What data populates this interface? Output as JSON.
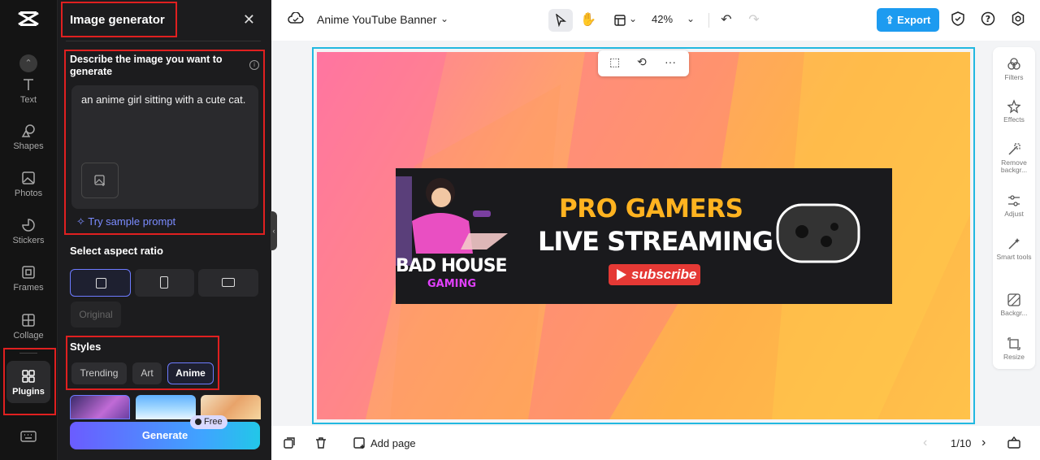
{
  "rail": {
    "logo_icon": "capcut-logo-icon",
    "items": [
      {
        "label": "Text",
        "icon": "text-icon"
      },
      {
        "label": "Shapes",
        "icon": "shapes-icon"
      },
      {
        "label": "Photos",
        "icon": "photos-icon"
      },
      {
        "label": "Stickers",
        "icon": "stickers-icon"
      },
      {
        "label": "Frames",
        "icon": "frames-icon"
      },
      {
        "label": "Collage",
        "icon": "collage-icon"
      }
    ],
    "plugins_label": "Plugins"
  },
  "panel": {
    "title": "Image generator",
    "describe_label": "Describe the image you want to generate",
    "prompt_value": "an anime girl sitting with a cute cat.",
    "sample_prompt": "Try sample prompt",
    "aspect_label": "Select aspect ratio",
    "original_label": "Original",
    "styles_label": "Styles",
    "style_tabs": [
      "Trending",
      "Art",
      "Anime"
    ],
    "active_style": "Anime",
    "generate_label": "Generate",
    "free_badge": "Free"
  },
  "topbar": {
    "doc_title": "Anime YouTube Banner",
    "zoom": "42%",
    "export_label": "Export"
  },
  "canvas": {
    "banner": {
      "title_line1": "PRO GAMERS",
      "title_line2": "LIVE STREAMING",
      "subscribe": "subscribe",
      "brand_line1": "BAD HOUSE",
      "brand_line2": "GAMING"
    }
  },
  "right_tools": [
    {
      "label": "Filters",
      "icon": "filters-icon"
    },
    {
      "label": "Effects",
      "icon": "effects-icon"
    },
    {
      "label": "Remove backgr...",
      "icon": "remove-background-icon"
    },
    {
      "label": "Adjust",
      "icon": "adjust-icon"
    },
    {
      "label": "Smart tools",
      "icon": "smart-tools-icon"
    },
    {
      "label": "Backgr...",
      "icon": "background-icon"
    },
    {
      "label": "Resize",
      "icon": "resize-icon"
    }
  ],
  "bottombar": {
    "add_page": "Add page",
    "page_indicator": "1/10"
  },
  "colors": {
    "accent": "#1d9bf0",
    "highlight_box": "#e02020",
    "canvas_selection": "#22b8e0",
    "banner_title": "#ffb320"
  }
}
